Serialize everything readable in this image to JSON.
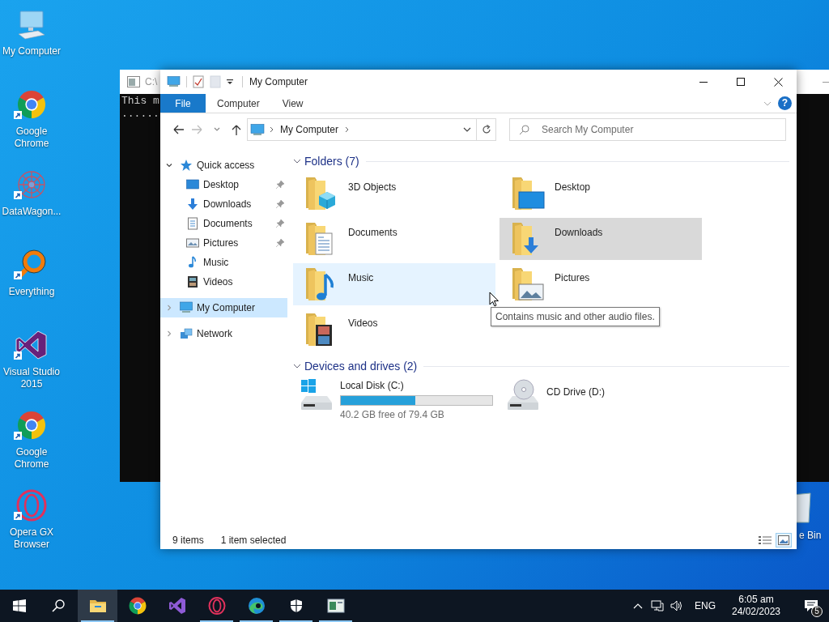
{
  "desktop": {
    "icons": [
      {
        "label": "My Computer",
        "kind": "computer",
        "shortcut": false
      },
      {
        "label": "Google Chrome",
        "kind": "chrome",
        "shortcut": true
      },
      {
        "label": "DataWagon...",
        "kind": "datawagon",
        "shortcut": true
      },
      {
        "label": "Everything",
        "kind": "everything",
        "shortcut": true
      },
      {
        "label": "Visual Studio 2015",
        "kind": "vs",
        "shortcut": true
      },
      {
        "label": "Google Chrome",
        "kind": "chrome",
        "shortcut": true
      },
      {
        "label": "Opera GX Browser",
        "kind": "opera",
        "shortcut": true
      }
    ],
    "recycle_bin_label": "e Bin"
  },
  "console": {
    "title": "C:\\",
    "lines": [
      "This m",
      "......"
    ]
  },
  "explorer": {
    "title": "My Computer",
    "help_glyph": "?",
    "ribbon_tabs": [
      {
        "label": "File",
        "kind": "file"
      },
      {
        "label": "Computer",
        "kind": "tab"
      },
      {
        "label": "View",
        "kind": "tab"
      }
    ],
    "address": {
      "path": [
        "My Computer"
      ]
    },
    "search": {
      "placeholder": "Search My Computer"
    },
    "nav": [
      {
        "label": "Quick access",
        "kind": "quick",
        "expanded": true,
        "selected": false,
        "children": [
          {
            "label": "Desktop",
            "kind": "desktop",
            "pinned": true
          },
          {
            "label": "Downloads",
            "kind": "downloads",
            "pinned": true
          },
          {
            "label": "Documents",
            "kind": "documents",
            "pinned": true
          },
          {
            "label": "Pictures",
            "kind": "pictures",
            "pinned": true
          },
          {
            "label": "Music",
            "kind": "music",
            "pinned": false
          },
          {
            "label": "Videos",
            "kind": "videos",
            "pinned": false
          }
        ]
      },
      {
        "label": "My Computer",
        "kind": "computer",
        "expanded": false,
        "selected": true
      },
      {
        "label": "Network",
        "kind": "network",
        "expanded": false,
        "selected": false
      }
    ],
    "folders": {
      "heading": "Folders (7)",
      "expanded": true,
      "items": [
        {
          "label": "3D Objects",
          "kind": "objects3d",
          "selected": false,
          "hovered": false
        },
        {
          "label": "Desktop",
          "kind": "desktop",
          "selected": false,
          "hovered": false
        },
        {
          "label": "Documents",
          "kind": "documents",
          "selected": false,
          "hovered": false
        },
        {
          "label": "Downloads",
          "kind": "downloads",
          "selected": true,
          "hovered": false
        },
        {
          "label": "Music",
          "kind": "music",
          "selected": false,
          "hovered": true
        },
        {
          "label": "Pictures",
          "kind": "pictures",
          "selected": false,
          "hovered": false
        },
        {
          "label": "Videos",
          "kind": "videos",
          "selected": false,
          "hovered": false
        }
      ]
    },
    "tooltip": "Contains music and other audio files.",
    "drives": {
      "heading": "Devices and drives (2)",
      "expanded": true,
      "items": [
        {
          "label": "Local Disk (C:)",
          "kind": "system",
          "level": 0.49,
          "reading": "40.2 GB free of 79.4 GB"
        },
        {
          "label": "CD Drive (D:)",
          "kind": "cd"
        }
      ]
    },
    "status_bar": {
      "item_count": "9 items",
      "selection": "1 item selected",
      "views": [
        {
          "kind": "details",
          "selected": false
        },
        {
          "kind": "large_icons",
          "selected": true
        }
      ]
    }
  },
  "taskbar": {
    "items": [
      {
        "kind": "start",
        "running": false,
        "active": false
      },
      {
        "kind": "search",
        "running": false,
        "active": false
      },
      {
        "kind": "explorer",
        "running": true,
        "active": true
      },
      {
        "kind": "chrome",
        "running": false,
        "active": false
      },
      {
        "kind": "vs",
        "running": false,
        "active": false
      },
      {
        "kind": "opera",
        "running": true,
        "active": false
      },
      {
        "kind": "edge",
        "running": true,
        "active": false
      },
      {
        "kind": "security",
        "running": true,
        "active": false
      },
      {
        "kind": "app",
        "running": true,
        "active": false
      }
    ],
    "tray": {
      "language": "ENG",
      "time": "6:05 am",
      "date": "24/02/2023",
      "notifications": "5"
    }
  }
}
